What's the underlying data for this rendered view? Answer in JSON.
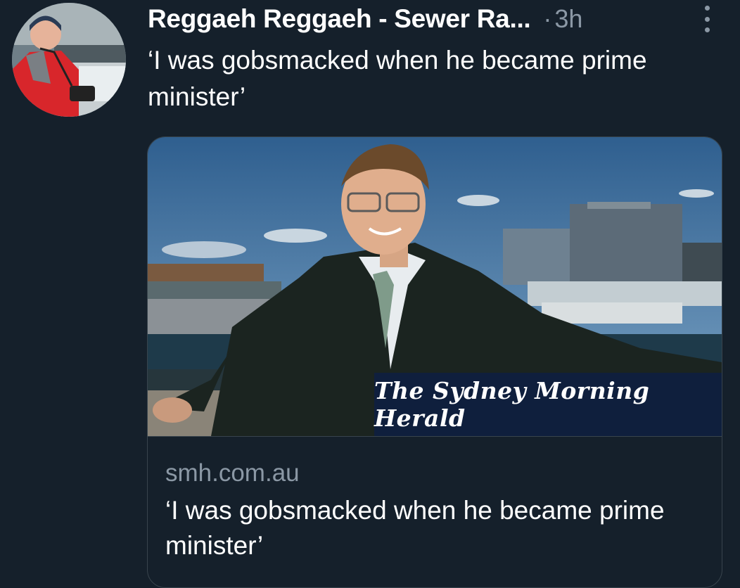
{
  "tweet": {
    "author": {
      "display_name": "Reggaeh Reggaeh - Sewer Ra...",
      "avatar_icon": "user-avatar-photo"
    },
    "separator": "·",
    "timestamp": "3h",
    "more_icon": "more-vertical-icon",
    "text": "‘I was gobsmacked when he became prime minister’"
  },
  "card": {
    "image_icon": "article-photo",
    "masthead": "The Sydney Morning Herald",
    "domain": "smh.com.au",
    "title": "‘I was gobsmacked when he became prime minister’"
  },
  "colors": {
    "background": "#15202b",
    "secondary_text": "#8b98a5",
    "border": "#38444d",
    "masthead_bg": "#0f1f3d"
  }
}
